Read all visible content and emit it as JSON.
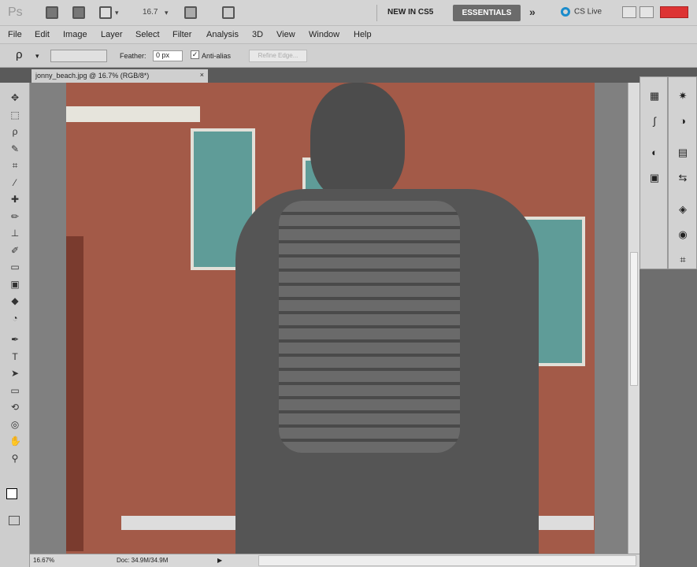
{
  "app": {
    "logo": "Ps",
    "zoom_dropdown": "16.7",
    "new_in_cs5": "NEW IN CS5",
    "workspace": "ESSENTIALS",
    "more": "»",
    "cs_live": "CS Live"
  },
  "menu": [
    "File",
    "Edit",
    "Image",
    "Layer",
    "Select",
    "Filter",
    "Analysis",
    "3D",
    "View",
    "Window",
    "Help"
  ],
  "options": {
    "feather_label": "Feather:",
    "feather_value": "0 px",
    "antialias_label": "Anti-alias",
    "antialias_checked": true,
    "refine_edge": "Refine Edge..."
  },
  "document": {
    "tab_title": "jonny_beach.jpg @ 16.7% (RGB/8*)",
    "close": "×"
  },
  "status": {
    "zoom": "16.67%",
    "doc_info": "Doc: 34.9M/34.9M"
  },
  "tools": [
    "move",
    "rect-marquee",
    "lasso",
    "quick-select",
    "crop",
    "eyedropper",
    "spot-heal",
    "brush",
    "clone-stamp",
    "history-brush",
    "eraser",
    "gradient",
    "blur",
    "dodge",
    "pen",
    "type",
    "path-select",
    "rectangle",
    "3d-rotate",
    "3d-orbit",
    "hand",
    "zoom"
  ]
}
